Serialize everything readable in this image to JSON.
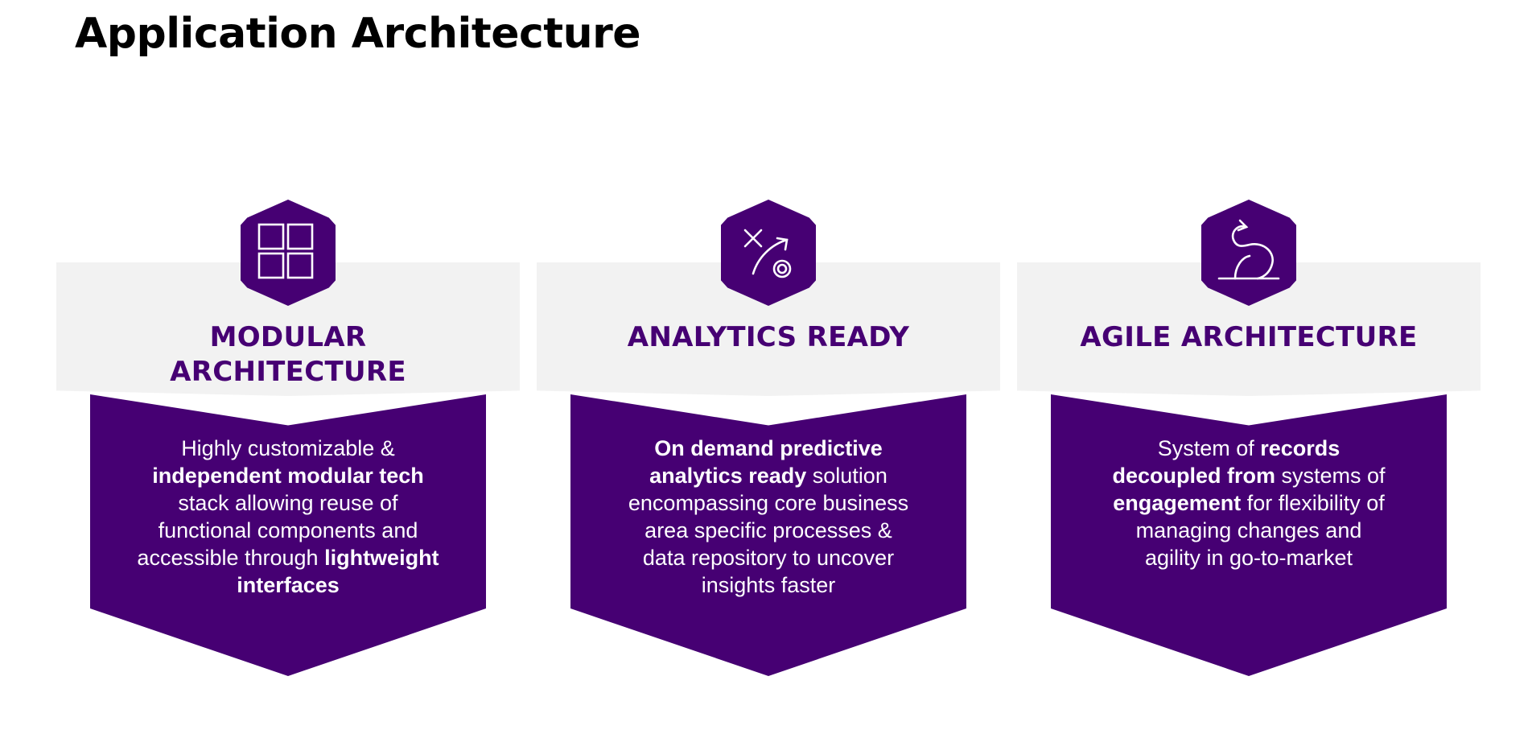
{
  "title": "Application Architecture",
  "colors": {
    "brand_purple": "#460073",
    "panel_grey": "#f2f2f2",
    "text_white": "#ffffff",
    "title_black": "#000000"
  },
  "cards": [
    {
      "icon": "grid-icon",
      "title_lines": [
        "MODULAR",
        "ARCHITECTURE"
      ],
      "body": [
        {
          "t": "Highly customizable &",
          "b": false
        },
        {
          "t": "independent modular tech",
          "b": true
        },
        {
          "t": "stack allowing reuse of",
          "b": false
        },
        {
          "t": "functional components and",
          "b": false
        },
        {
          "t": "accessible through",
          "b": false
        },
        {
          "t": "lightweight",
          "b": true
        },
        {
          "t": "interfaces",
          "b": true
        }
      ]
    },
    {
      "icon": "strategy-play-icon",
      "title_lines": [
        "ANALYTICS READY"
      ],
      "body": [
        {
          "t": "On demand predictive",
          "b": true
        },
        {
          "t": "analytics ready",
          "b": true
        },
        {
          "t": "solution",
          "b": false
        },
        {
          "t": "encompassing core business",
          "b": false
        },
        {
          "t": "area specific processes &",
          "b": false
        },
        {
          "t": "data repository to uncover",
          "b": false
        },
        {
          "t": "insights faster",
          "b": false
        }
      ]
    },
    {
      "icon": "agile-cycle-icon",
      "title_lines": [
        "AGILE ARCHITECTURE"
      ],
      "body": [
        {
          "t": "System of",
          "b": false
        },
        {
          "t": "records",
          "b": true
        },
        {
          "t": "decoupled from",
          "b": true
        },
        {
          "t": "systems of",
          "b": false
        },
        {
          "t": "engagement",
          "b": true
        },
        {
          "t": "for flexibility of",
          "b": false
        },
        {
          "t": "managing changes and",
          "b": false
        },
        {
          "t": "agility in go-to-market",
          "b": false
        }
      ]
    }
  ]
}
